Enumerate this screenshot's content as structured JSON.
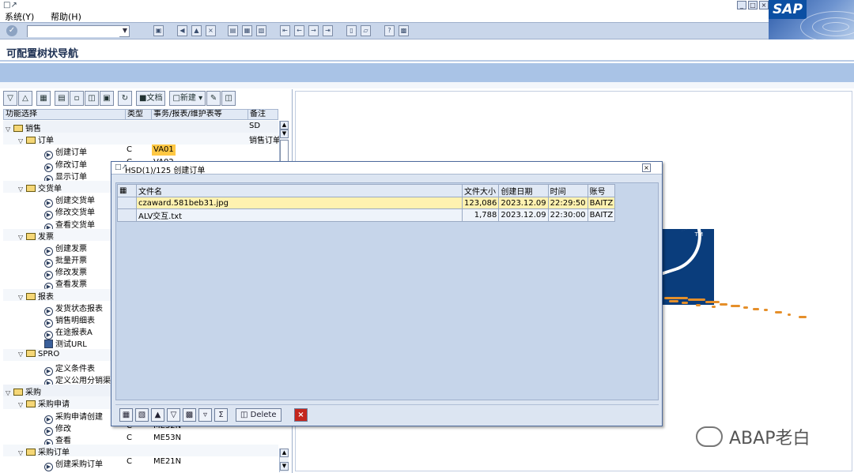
{
  "menu": {
    "items": [
      "系统(Y)",
      "帮助(H)"
    ]
  },
  "sap_logo": "SAP",
  "toolbar": {
    "command_value": ""
  },
  "page_title": "可配置树状导航",
  "tree_toolbar": {
    "doc_label": "文档",
    "new_label": "新建"
  },
  "tree_header": {
    "col_function": "功能选择",
    "col_type": "类型",
    "col_tcode": "事务/报表/维护表等",
    "col_note": "备注"
  },
  "tree_rows": [
    {
      "kind": "folder",
      "level": 1,
      "label": "销售",
      "type": "",
      "tcode": "",
      "note": "SD"
    },
    {
      "kind": "folder",
      "level": 2,
      "label": "订单",
      "type": "",
      "tcode": "",
      "note": "销售订单"
    },
    {
      "kind": "tcode",
      "label": "创建订单",
      "type": "C",
      "tcode": "VA01",
      "note": "",
      "highlight": true
    },
    {
      "kind": "tcode",
      "label": "修改订单",
      "type": "C",
      "tcode": "VA02",
      "note": ""
    },
    {
      "kind": "tcode",
      "label": "显示订单",
      "type": "",
      "tcode": "",
      "note": ""
    },
    {
      "kind": "folder",
      "level": 2,
      "label": "交货单",
      "type": "",
      "tcode": "",
      "note": ""
    },
    {
      "kind": "tcode",
      "label": "创建交货单",
      "type": "",
      "tcode": "",
      "note": ""
    },
    {
      "kind": "tcode",
      "label": "修改交货单",
      "type": "",
      "tcode": "",
      "note": ""
    },
    {
      "kind": "tcode",
      "label": "查看交货单",
      "type": "",
      "tcode": "",
      "note": ""
    },
    {
      "kind": "folder",
      "level": 2,
      "label": "发票",
      "type": "",
      "tcode": "",
      "note": ""
    },
    {
      "kind": "tcode",
      "label": "创建发票",
      "type": "",
      "tcode": "",
      "note": ""
    },
    {
      "kind": "tcode",
      "label": "批量开票",
      "type": "",
      "tcode": "",
      "note": ""
    },
    {
      "kind": "tcode",
      "label": "修改发票",
      "type": "",
      "tcode": "",
      "note": ""
    },
    {
      "kind": "tcode",
      "label": "查看发票",
      "type": "",
      "tcode": "",
      "note": ""
    },
    {
      "kind": "folder",
      "level": 2,
      "label": "报表",
      "type": "",
      "tcode": "",
      "note": ""
    },
    {
      "kind": "tcode",
      "label": "发货状态报表",
      "type": "",
      "tcode": "",
      "note": ""
    },
    {
      "kind": "tcode",
      "label": "销售明细表",
      "type": "",
      "tcode": "",
      "note": ""
    },
    {
      "kind": "tcode",
      "label": "在途报表A",
      "type": "",
      "tcode": "",
      "note": ""
    },
    {
      "kind": "url",
      "label": "测试URL",
      "type": "",
      "tcode": "",
      "note": ""
    },
    {
      "kind": "folder",
      "level": 2,
      "label": "SPRO",
      "type": "",
      "tcode": "",
      "note": ""
    },
    {
      "kind": "tcode",
      "label": "定义条件表",
      "type": "",
      "tcode": "",
      "note": ""
    },
    {
      "kind": "tcode",
      "label": "定义公用分销渠",
      "type": "",
      "tcode": "",
      "note": ""
    },
    {
      "kind": "folder",
      "level": 1,
      "label": "采购",
      "type": "",
      "tcode": "",
      "note": ""
    },
    {
      "kind": "folder",
      "level": 2,
      "label": "采购申请",
      "type": "",
      "tcode": "",
      "note": ""
    },
    {
      "kind": "tcode",
      "label": "采购申请创建",
      "type": "",
      "tcode": "",
      "note": ""
    },
    {
      "kind": "tcode",
      "label": "修改",
      "type": "C",
      "tcode": "ME52N",
      "note": ""
    },
    {
      "kind": "tcode",
      "label": "查看",
      "type": "C",
      "tcode": "ME53N",
      "note": ""
    },
    {
      "kind": "folder",
      "level": 2,
      "label": "采购订单",
      "type": "",
      "tcode": "",
      "note": ""
    },
    {
      "kind": "tcode",
      "label": "创建采购订单",
      "type": "C",
      "tcode": "ME21N",
      "note": ""
    }
  ],
  "dialog": {
    "title": "HSD(1)/125 创建订单",
    "columns": [
      "文件名",
      "文件大小",
      "创建日期",
      "时间",
      "账号"
    ],
    "rows": [
      {
        "filename": "czaward.581beb31.jpg",
        "size": "123,086",
        "date": "2023.12.09",
        "time": "22:29:50",
        "user": "BAITZ"
      },
      {
        "filename": "ALV交互.txt",
        "size": "1,788",
        "date": "2023.12.09",
        "time": "22:30:00",
        "user": "BAITZ"
      }
    ],
    "delete_label": "Delete"
  },
  "watermark": "ABAP老白",
  "colors": {
    "header_blue": "#a9c3e6",
    "toolbar": "#c9d6ea",
    "highlight": "#ffc844",
    "selected_row": "#fff2b0",
    "logo_navy": "#0a3d7c",
    "cancel_red": "#c4261d"
  }
}
